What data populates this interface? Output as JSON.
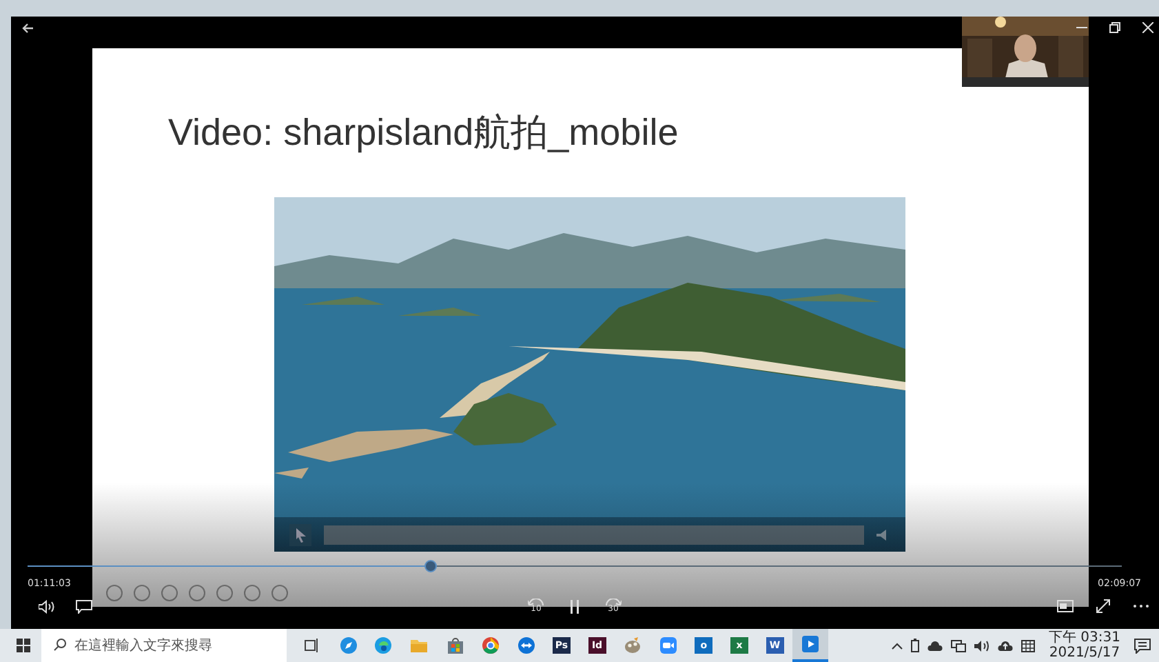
{
  "slide": {
    "title": "Video: sharpisland航拍_mobile"
  },
  "player": {
    "progress": {
      "level": 0.37
    },
    "elapsed": "01:11:03",
    "duration": "02:09:07",
    "skip_back": "10",
    "skip_forward": "30",
    "playing": true
  },
  "taskbar": {
    "search": {
      "placeholder": "在這裡輸入文字來搜尋"
    },
    "apps": [
      {
        "kind": "taskview",
        "selected": false
      },
      {
        "kind": "compass",
        "selected": false
      },
      {
        "kind": "edge",
        "selected": false
      },
      {
        "kind": "folder",
        "selected": false
      },
      {
        "kind": "store",
        "selected": false
      },
      {
        "kind": "chrome",
        "selected": false
      },
      {
        "kind": "remote",
        "selected": false
      },
      {
        "kind": "letter",
        "label": "Ps",
        "color": "#1b2a4a",
        "selected": false
      },
      {
        "kind": "letter",
        "label": "Id",
        "color": "#4a0f2a",
        "selected": false
      },
      {
        "kind": "paint",
        "selected": false
      },
      {
        "kind": "camera",
        "selected": false
      },
      {
        "kind": "letter",
        "label": "o",
        "color": "#0f6cbd",
        "selected": false
      },
      {
        "kind": "letter",
        "label": "x",
        "color": "#1d7a45",
        "selected": false
      },
      {
        "kind": "letter",
        "label": "W",
        "color": "#2b5eb0",
        "selected": false
      },
      {
        "kind": "player",
        "selected": true
      }
    ],
    "time": "下午 03:31",
    "date": "2021/5/17"
  }
}
